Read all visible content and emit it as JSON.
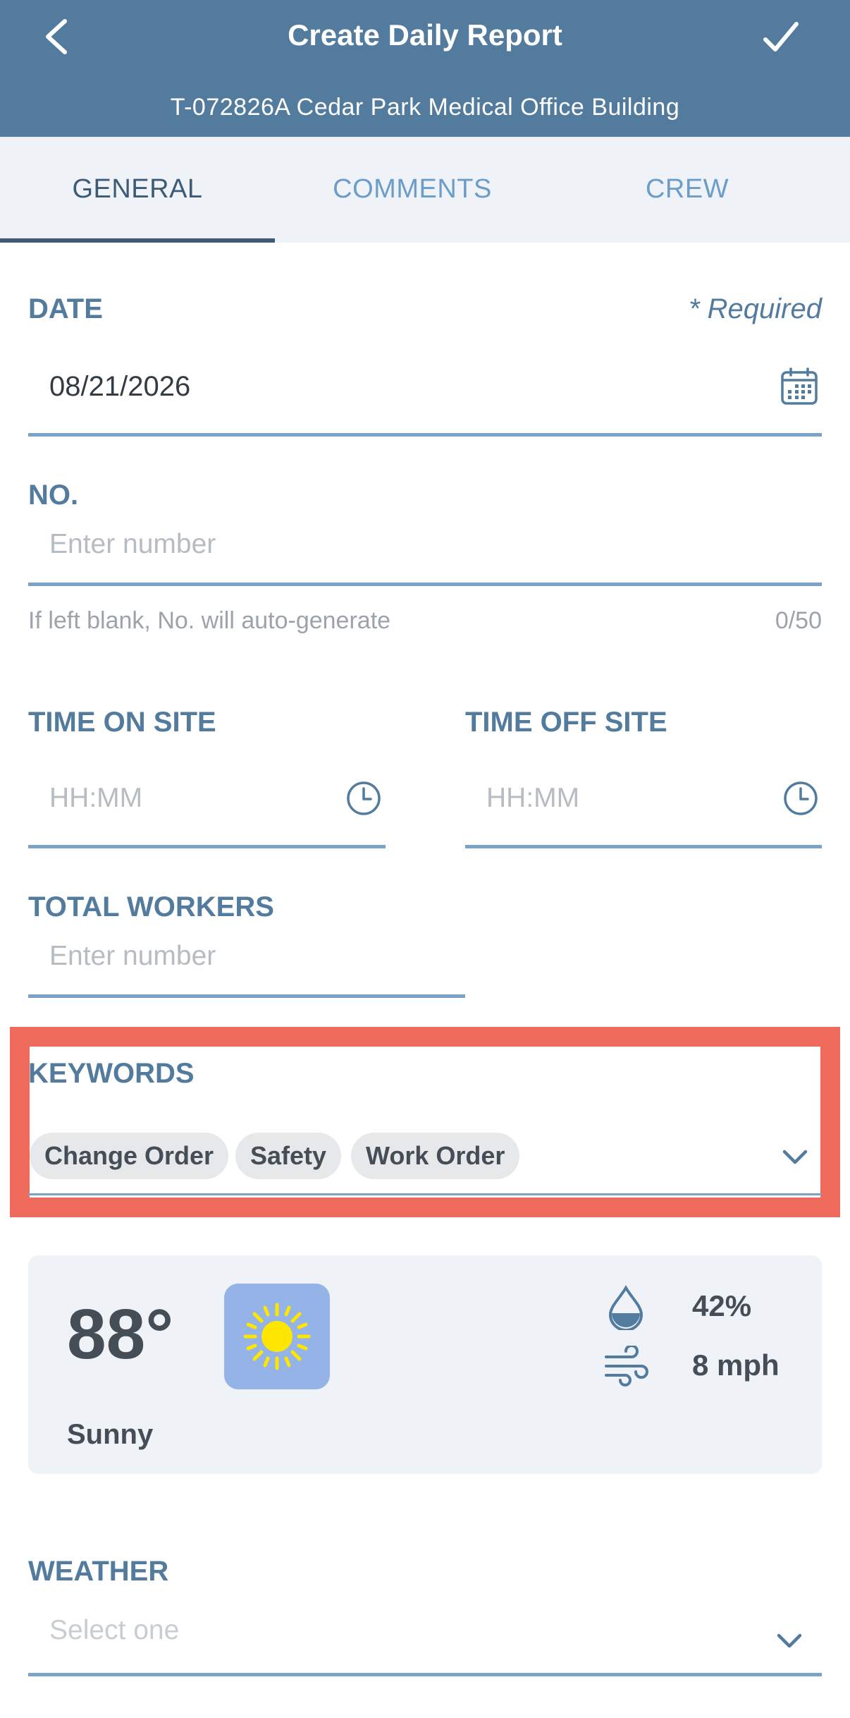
{
  "header": {
    "title": "Create Daily Report",
    "subtitle": "T-072826A Cedar Park Medical Office Building",
    "back_icon": "chevron-left-icon",
    "save_icon": "checkmark-icon"
  },
  "tabs": [
    {
      "label": "GENERAL",
      "active": true
    },
    {
      "label": "COMMENTS",
      "active": false
    },
    {
      "label": "CREW",
      "active": false
    }
  ],
  "form": {
    "date": {
      "label": "DATE",
      "required": "* Required",
      "value": "08/21/2026",
      "icon": "calendar-icon"
    },
    "number": {
      "label": "NO.",
      "placeholder": "Enter number",
      "helper": "If left blank, No. will auto-generate",
      "counter": "0/50"
    },
    "time_on_site": {
      "label": "TIME ON SITE",
      "placeholder": "HH:MM",
      "icon": "clock-icon"
    },
    "time_off_site": {
      "label": "TIME OFF SITE",
      "placeholder": "HH:MM",
      "icon": "clock-icon"
    },
    "total_workers": {
      "label": "TOTAL WORKERS",
      "placeholder": "Enter number"
    },
    "keywords": {
      "label": "KEYWORDS",
      "chips": [
        "Change Order",
        "Safety",
        "Work Order"
      ],
      "icon": "chevron-down-icon"
    },
    "weather_select": {
      "label": "WEATHER",
      "placeholder": "Select one",
      "icon": "chevron-down-icon"
    }
  },
  "weather_card": {
    "temperature": "88°",
    "condition": "Sunny",
    "condition_icon": "sun-icon",
    "humidity": "42%",
    "humidity_icon": "droplet-icon",
    "wind": "8 mph",
    "wind_icon": "wind-icon"
  },
  "colors": {
    "header": "#537b9d",
    "accent": "#537b9d",
    "highlight_frame": "#ee6a5a",
    "sun_tile": "#94b3e6",
    "sun": "#ffe600"
  }
}
